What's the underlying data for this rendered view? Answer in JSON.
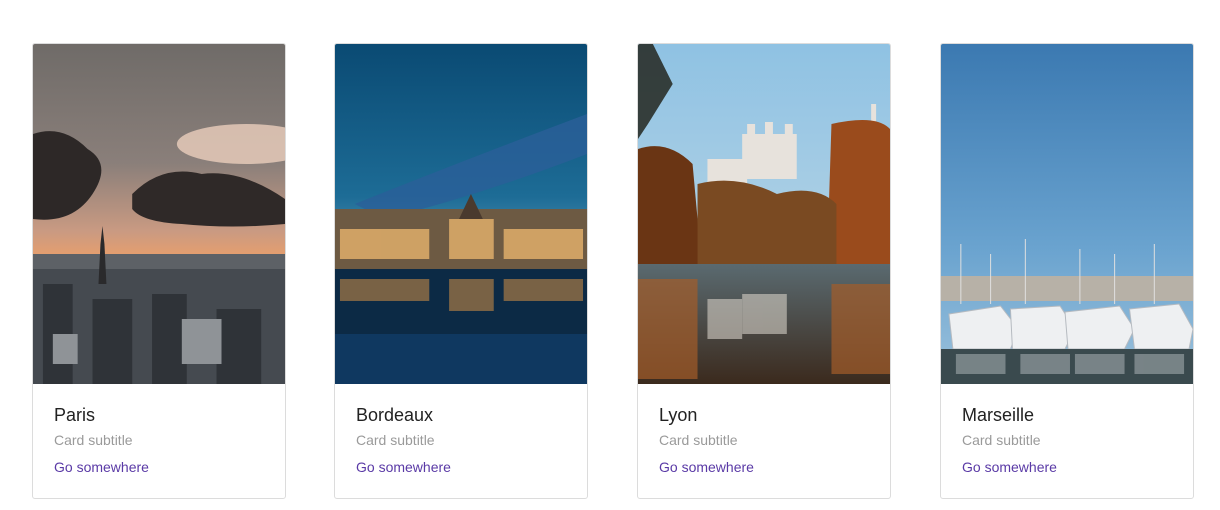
{
  "cards": [
    {
      "title": "Paris",
      "subtitle": "Card subtitle",
      "link": "Go somewhere",
      "image": "paris-eiffel-tower-skyline-sunset"
    },
    {
      "title": "Bordeaux",
      "subtitle": "Card subtitle",
      "link": "Go somewhere",
      "image": "bordeaux-place-de-la-bourse-reflection-dusk"
    },
    {
      "title": "Lyon",
      "subtitle": "Card subtitle",
      "link": "Go somewhere",
      "image": "lyon-fourviere-basilica-autumn-river"
    },
    {
      "title": "Marseille",
      "subtitle": "Card subtitle",
      "link": "Go somewhere",
      "image": "marseille-port-boats-blue-sky"
    }
  ],
  "colors": {
    "link": "#5a3aa6",
    "subtitle": "#9a9a9a",
    "title": "#222222",
    "border": "#dcdcdc"
  }
}
